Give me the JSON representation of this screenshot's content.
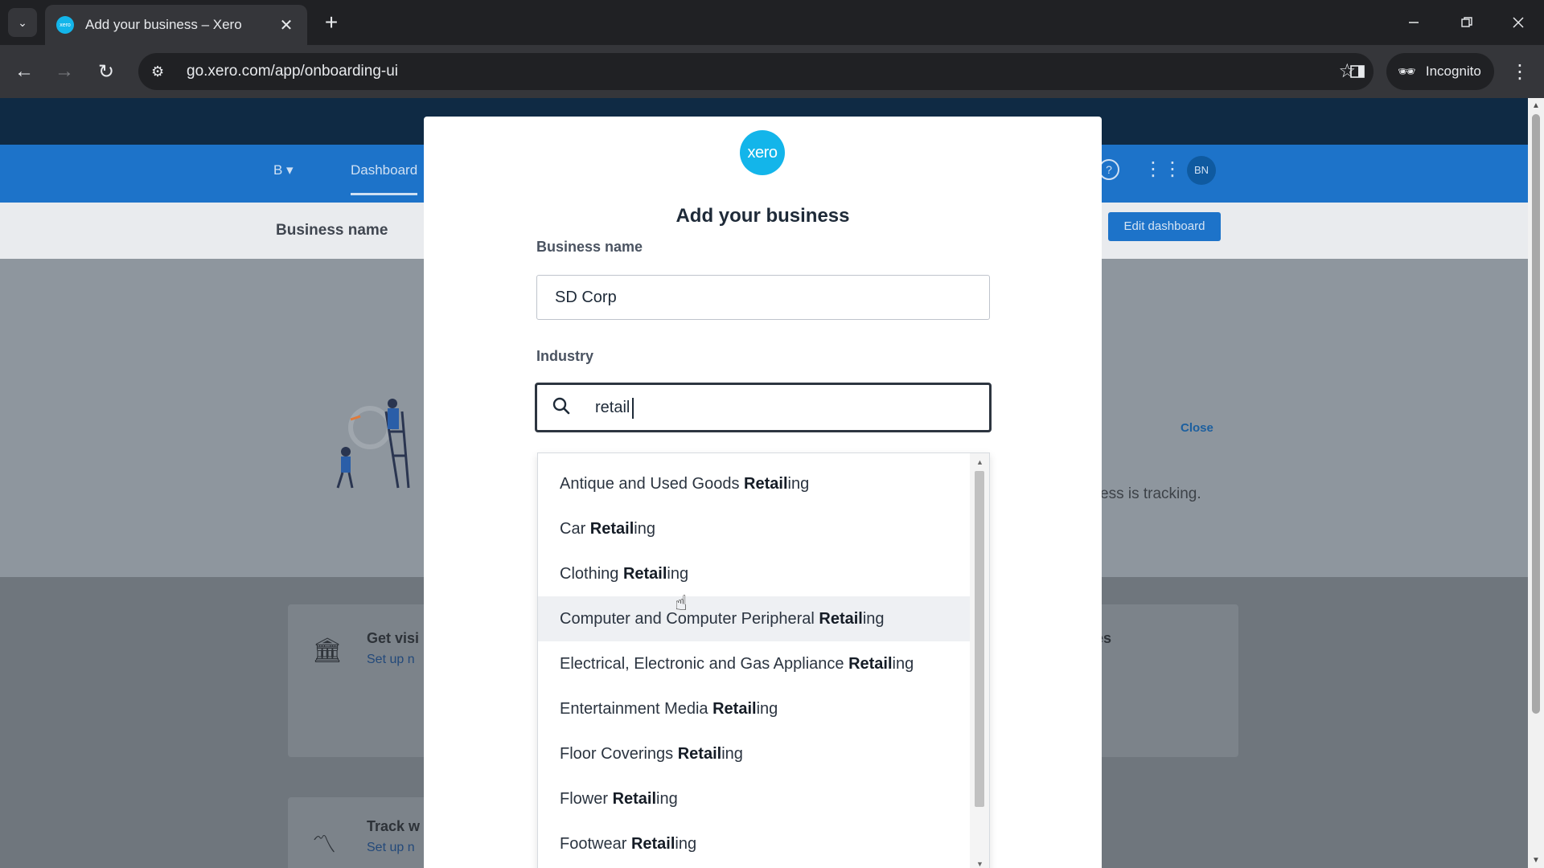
{
  "browser": {
    "tab_title": "Add your business – Xero",
    "favicon_text": "xero",
    "url": "go.xero.com/app/onboarding-ui",
    "incognito_label": "Incognito",
    "new_tab_glyph": "+",
    "close_glyph": "✕"
  },
  "background": {
    "org_switcher": "B ▾",
    "nav_dashboard": "Dashboard",
    "avatar_initials": "BN",
    "business_name_heading": "Business name",
    "edit_dashboard_label": "Edit dashboard",
    "close_link": "Close",
    "tracking_text": "ess is tracking.",
    "card1_title": "Get visi",
    "card1_sub": "Set up n",
    "card2_title": "Track w",
    "card2_sub": "Set up n",
    "card3_title": "es"
  },
  "modal": {
    "logo_text": "xero",
    "title": "Add your business",
    "business_name_label": "Business name",
    "business_name_value": "SD Corp",
    "industry_label": "Industry",
    "industry_search_value": "retail",
    "options": [
      {
        "prefix": "Antique and Used Goods ",
        "match": "Retail",
        "suffix": "ing"
      },
      {
        "prefix": "Car ",
        "match": "Retail",
        "suffix": "ing"
      },
      {
        "prefix": "Clothing ",
        "match": "Retail",
        "suffix": "ing"
      },
      {
        "prefix": "Computer and Computer Peripheral ",
        "match": "Retail",
        "suffix": "ing"
      },
      {
        "prefix": "Electrical, Electronic and Gas Appliance ",
        "match": "Retail",
        "suffix": "ing"
      },
      {
        "prefix": "Entertainment Media ",
        "match": "Retail",
        "suffix": "ing"
      },
      {
        "prefix": "Floor Coverings ",
        "match": "Retail",
        "suffix": "ing"
      },
      {
        "prefix": "Flower ",
        "match": "Retail",
        "suffix": "ing"
      },
      {
        "prefix": "Footwear ",
        "match": "Retail",
        "suffix": "ing"
      }
    ],
    "hovered_option_index": 3
  },
  "colors": {
    "xero_blue": "#13b5ea",
    "nav_blue": "#1d73c9",
    "text_dark": "#1e2a38"
  },
  "icons": {
    "search": "search-icon",
    "back": "arrow-left-icon",
    "forward": "arrow-right-icon",
    "reload": "reload-icon",
    "star": "star-icon",
    "incognito": "incognito-icon"
  }
}
